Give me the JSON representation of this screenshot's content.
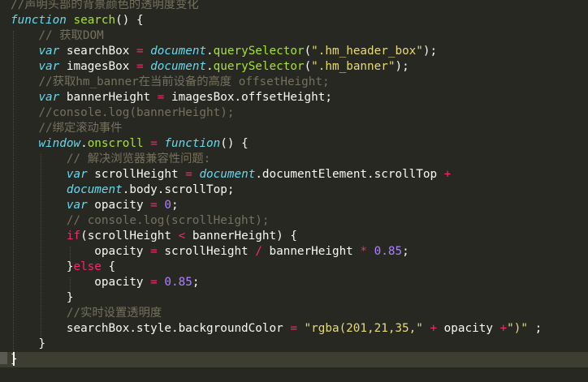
{
  "editor": {
    "theme": {
      "background": "#272822",
      "comment": "#75715E",
      "keyword": "#66D9EF",
      "operator": "#F92672",
      "function": "#A6E22E",
      "string": "#E6DB74",
      "number": "#AE81FF",
      "text": "#F8F8F2"
    },
    "lines": [
      [
        [
          "c",
          "//声明头部的背景颜色的透明度变化"
        ]
      ],
      [
        [
          "k",
          "function"
        ],
        [
          "p",
          " "
        ],
        [
          "f",
          "search"
        ],
        [
          "p",
          "() {"
        ]
      ],
      [
        [
          "p",
          "    "
        ],
        [
          "c",
          "// 获取DOM"
        ]
      ],
      [
        [
          "p",
          "    "
        ],
        [
          "k",
          "var"
        ],
        [
          "p",
          " searchBox "
        ],
        [
          "o",
          "="
        ],
        [
          "p",
          " "
        ],
        [
          "b",
          "document"
        ],
        [
          "p",
          "."
        ],
        [
          "f",
          "querySelector"
        ],
        [
          "p",
          "("
        ],
        [
          "s",
          "\".hm_header_box\""
        ],
        [
          "p",
          ");"
        ]
      ],
      [
        [
          "p",
          "    "
        ],
        [
          "k",
          "var"
        ],
        [
          "p",
          " imagesBox "
        ],
        [
          "o",
          "="
        ],
        [
          "p",
          " "
        ],
        [
          "b",
          "document"
        ],
        [
          "p",
          "."
        ],
        [
          "f",
          "querySelector"
        ],
        [
          "p",
          "("
        ],
        [
          "s",
          "\".hm_banner\""
        ],
        [
          "p",
          ");"
        ]
      ],
      [
        [
          "p",
          "    "
        ],
        [
          "c",
          "//获取hm_banner在当前设备的高度 offsetHeight;"
        ]
      ],
      [
        [
          "p",
          "    "
        ],
        [
          "k",
          "var"
        ],
        [
          "p",
          " bannerHeight "
        ],
        [
          "o",
          "="
        ],
        [
          "p",
          " imagesBox.offsetHeight;"
        ]
      ],
      [
        [
          "p",
          "    "
        ],
        [
          "c",
          "//console.log(bannerHeight);"
        ]
      ],
      [
        [
          "p",
          "    "
        ],
        [
          "c",
          "//绑定滚动事件"
        ]
      ],
      [
        [
          "p",
          "    "
        ],
        [
          "b",
          "window"
        ],
        [
          "p",
          "."
        ],
        [
          "f",
          "onscroll"
        ],
        [
          "p",
          " "
        ],
        [
          "o",
          "="
        ],
        [
          "p",
          " "
        ],
        [
          "k",
          "function"
        ],
        [
          "p",
          "() {"
        ]
      ],
      [
        [
          "p",
          "        "
        ],
        [
          "c",
          "// 解决浏览器兼容性问题:"
        ]
      ],
      [
        [
          "p",
          "        "
        ],
        [
          "k",
          "var"
        ],
        [
          "p",
          " scrollHeight "
        ],
        [
          "o",
          "="
        ],
        [
          "p",
          " "
        ],
        [
          "b",
          "document"
        ],
        [
          "p",
          ".documentElement.scrollTop "
        ],
        [
          "o",
          "+"
        ]
      ],
      [
        [
          "p",
          "        "
        ],
        [
          "b",
          "document"
        ],
        [
          "p",
          ".body.scrollTop;"
        ]
      ],
      [
        [
          "p",
          "        "
        ],
        [
          "k",
          "var"
        ],
        [
          "p",
          " opacity "
        ],
        [
          "o",
          "="
        ],
        [
          "p",
          " "
        ],
        [
          "n",
          "0"
        ],
        [
          "p",
          ";"
        ]
      ],
      [
        [
          "p",
          "        "
        ],
        [
          "c",
          "// console.log(scrollHeight);"
        ]
      ],
      [
        [
          "p",
          "        "
        ],
        [
          "r",
          "if"
        ],
        [
          "p",
          "(scrollHeight "
        ],
        [
          "o",
          "<"
        ],
        [
          "p",
          " bannerHeight) {"
        ]
      ],
      [
        [
          "p",
          "            opacity "
        ],
        [
          "o",
          "="
        ],
        [
          "p",
          " scrollHeight "
        ],
        [
          "o",
          "/"
        ],
        [
          "p",
          " bannerHeight "
        ],
        [
          "o",
          "*"
        ],
        [
          "p",
          " "
        ],
        [
          "n",
          "0.85"
        ],
        [
          "p",
          ";"
        ]
      ],
      [
        [
          "p",
          "        }"
        ],
        [
          "r",
          "else"
        ],
        [
          "p",
          " {"
        ]
      ],
      [
        [
          "p",
          "            opacity "
        ],
        [
          "o",
          "="
        ],
        [
          "p",
          " "
        ],
        [
          "n",
          "0.85"
        ],
        [
          "p",
          ";"
        ]
      ],
      [
        [
          "p",
          "        }"
        ]
      ],
      [
        [
          "p",
          "        "
        ],
        [
          "c",
          "//实时设置透明度"
        ]
      ],
      [
        [
          "p",
          "        searchBox.style.backgroundColor "
        ],
        [
          "o",
          "="
        ],
        [
          "p",
          " "
        ],
        [
          "s",
          "\"rgba(201,21,35,\""
        ],
        [
          "p",
          " "
        ],
        [
          "o",
          "+"
        ],
        [
          "p",
          " opacity "
        ],
        [
          "o",
          "+"
        ],
        [
          "s",
          "\")\""
        ],
        [
          "p",
          " ;"
        ]
      ],
      [
        [
          "p",
          "    }"
        ]
      ],
      [
        [
          "p",
          "}"
        ]
      ]
    ]
  }
}
